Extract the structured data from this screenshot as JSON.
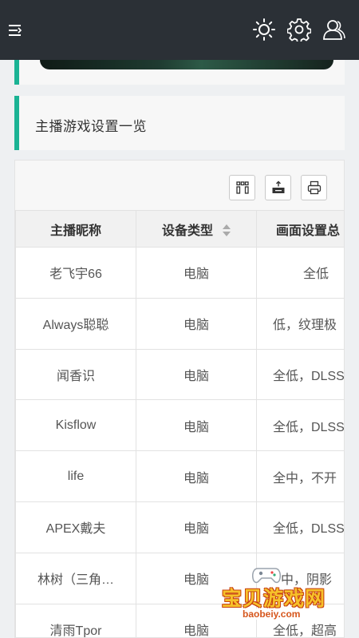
{
  "header": {
    "menu_icon": "menu-icon",
    "icons": [
      "brightness-icon",
      "settings-gear-icon",
      "user-profile-icon"
    ]
  },
  "section": {
    "title": "主播游戏设置一览"
  },
  "toolbar": {
    "icons": [
      "columns-grid-icon",
      "export-icon",
      "print-icon"
    ]
  },
  "table": {
    "columns": [
      "主播昵称",
      "设备类型",
      "画面设置总"
    ],
    "rows": [
      [
        "老飞宇66",
        "电脑",
        "全低"
      ],
      [
        "Always聪聪",
        "电脑",
        "低，纹理极"
      ],
      [
        "闻香识",
        "电脑",
        "全低，DLSS"
      ],
      [
        "Kisflow",
        "电脑",
        "全低，DLSS"
      ],
      [
        "life",
        "电脑",
        "全中，不开"
      ],
      [
        "APEX戴夫",
        "电脑",
        "全低，DLSS"
      ],
      [
        "林树（三角…",
        "电脑",
        "中，阴影"
      ],
      [
        "清雨Tpor",
        "电脑",
        "全低，超高"
      ]
    ]
  },
  "watermark": {
    "text": "宝贝游戏网",
    "url": "baobeiy.com"
  },
  "colors": {
    "topbar": "#2b3036",
    "accent": "#1ab394",
    "watermark_yellow": "#f6c12b",
    "watermark_orange": "#d6561c"
  }
}
